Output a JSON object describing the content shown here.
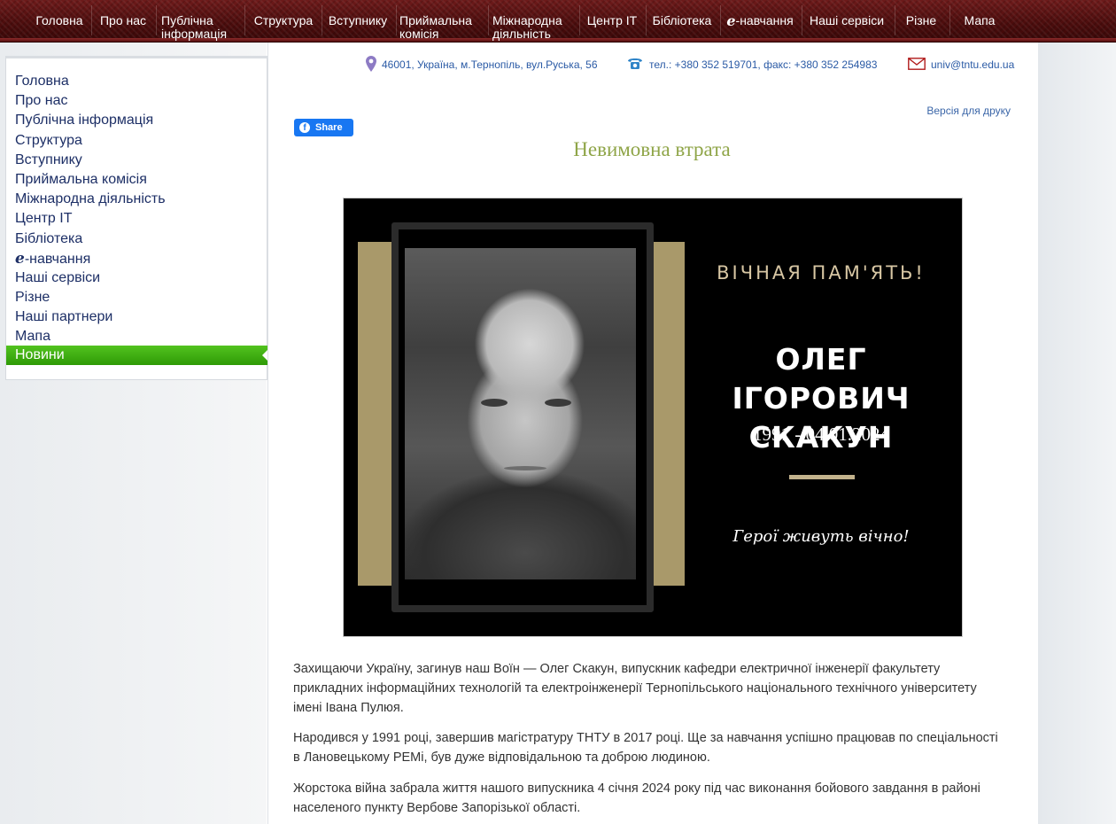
{
  "top_nav": {
    "items": [
      {
        "label": "Головна"
      },
      {
        "label": "Про нас"
      },
      {
        "label_line1": "Публічна",
        "label_line2": "інформація"
      },
      {
        "label": "Структура"
      },
      {
        "label": "Вступнику"
      },
      {
        "label_line1": "Приймальна",
        "label_line2": "комісія"
      },
      {
        "label_line1": "Міжнародна",
        "label_line2": "діяльність"
      },
      {
        "label": "Центр IT"
      },
      {
        "label": "Бібліотека"
      },
      {
        "e_letter": "e",
        "label": "-навчання"
      },
      {
        "label": "Наші сервіси"
      },
      {
        "label": "Різне"
      },
      {
        "label": "Мапа"
      }
    ]
  },
  "sidebar": {
    "items": [
      {
        "label": "Головна"
      },
      {
        "label": "Про нас"
      },
      {
        "label": "Публічна інформація"
      },
      {
        "label": "Структура"
      },
      {
        "label": "Вступнику"
      },
      {
        "label": "Приймальна комісія"
      },
      {
        "label": "Міжнародна діяльність"
      },
      {
        "label": "Центр IT"
      },
      {
        "label": "Бібліотека"
      },
      {
        "e_letter": "e",
        "label": "-навчання"
      },
      {
        "label": "Наші сервіси"
      },
      {
        "label": "Різне"
      },
      {
        "label": "Наші партнери"
      },
      {
        "label": "Мапа"
      }
    ],
    "active_label": "Новини",
    "active_color": "#3fae13"
  },
  "header": {
    "address": "46001, Україна, м.Тернопіль, вул.Руська, 56",
    "phone": "тел.: +380 352 519701, факс: +380 352 254983",
    "email": "univ@tntu.edu.ua",
    "print_link": "Версія для друку",
    "share_label": "Share"
  },
  "article": {
    "title": "Невимовна втрата",
    "title_color": "#8fa548",
    "memorial": {
      "eternal": "ВІЧНАЯ ПАМ'ЯТЬ!",
      "name_line1": "ОЛЕГ ІГОРОВИЧ",
      "name_line2": "СКАКУН",
      "dates": "1991 - 04.01.2024",
      "heroes": "Герої живуть вічно!"
    },
    "paragraphs": [
      "Захищаючи Україну, загинув наш Воїн — Олег Скакун, випускник кафедри електричної інженерії факультету прикладних інформаційних технологій та електроінженерії Тернопільського національного технічного університету імені Івана Пулюя.",
      "Народився у 1991 році, завершив магістратуру ТНТУ в 2017 році. Ще за навчання успішно працював по спеціальності в Лановецькому РЕМі, був дуже відповідальною та доброю людиною.",
      "Жорстока війна забрала життя нашого випускника 4 січня 2024 року під час виконання бойового завдання в районі населеного пункту Вербове Запорізької області."
    ]
  }
}
